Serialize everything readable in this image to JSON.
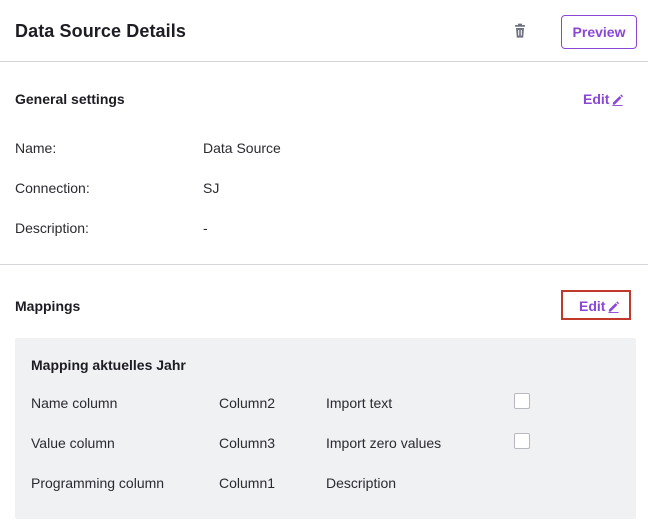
{
  "header": {
    "title": "Data Source Details",
    "preview_label": "Preview"
  },
  "general": {
    "title": "General settings",
    "edit_label": "Edit",
    "fields": [
      {
        "label": "Name:",
        "value": "Data Source"
      },
      {
        "label": "Connection:",
        "value": "SJ"
      },
      {
        "label": "Description:",
        "value": "-"
      }
    ]
  },
  "mappings": {
    "title": "Mappings",
    "edit_label": "Edit",
    "box": {
      "title": "Mapping aktuelles Jahr",
      "rows": [
        {
          "label": "Name column",
          "value": "Column2",
          "option": "Import text",
          "checked": false
        },
        {
          "label": "Value column",
          "value": "Column3",
          "option": "Import zero values",
          "checked": false
        },
        {
          "label": "Programming column",
          "value": "Column1",
          "option": "Description"
        }
      ]
    }
  },
  "colors": {
    "accent": "#8a47d6",
    "highlight": "#c0392b",
    "panel": "#f0f1f3"
  },
  "icons": [
    "trash-icon",
    "pencil-icon"
  ]
}
